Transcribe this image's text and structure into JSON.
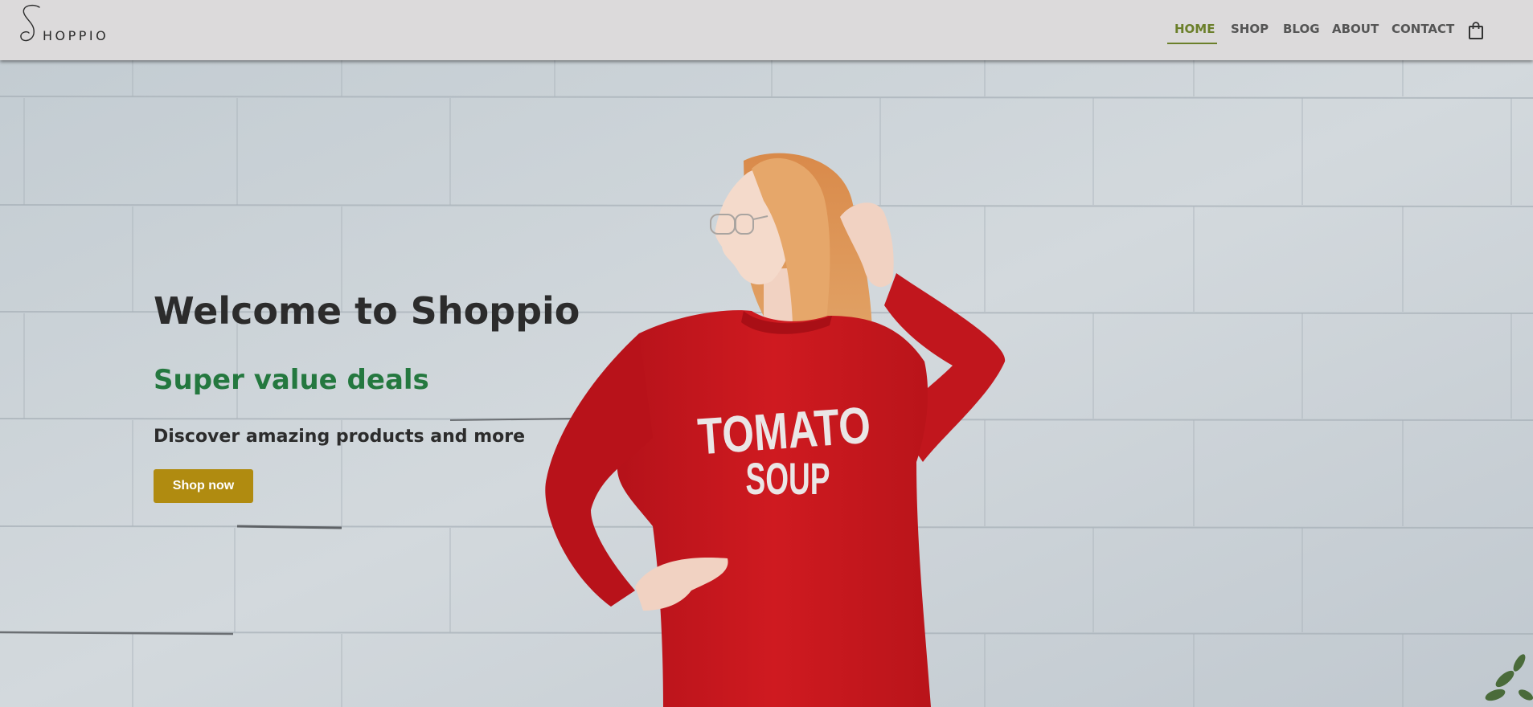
{
  "brand": {
    "logo_text": "HOPPIO"
  },
  "nav": {
    "items": [
      {
        "label": "HOME",
        "active": true
      },
      {
        "label": "SHOP",
        "active": false
      },
      {
        "label": "BLOG",
        "active": false
      },
      {
        "label": "ABOUT",
        "active": false
      },
      {
        "label": "CONTACT",
        "active": false
      }
    ],
    "cart_icon": "shopping-bag-icon",
    "active_color": "#6b7f2a"
  },
  "hero": {
    "title": "Welcome to Shoppio",
    "subtitle": "Super value deals",
    "description": "Discover amazing products and more",
    "cta_label": "Shop now",
    "sweater_print_line1": "TOMATO",
    "sweater_print_line2": "SOUP",
    "colors": {
      "subtitle": "#24783f",
      "button": "#b08b10",
      "sweater": "#c8171d"
    }
  }
}
